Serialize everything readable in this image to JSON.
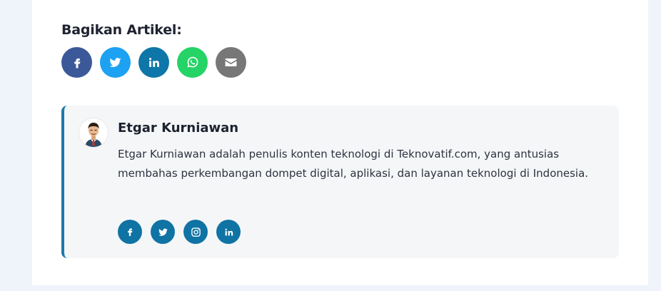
{
  "share": {
    "title": "Bagikan Artikel:",
    "buttons": [
      {
        "icon": "facebook-icon",
        "color": "#3b5998"
      },
      {
        "icon": "twitter-icon",
        "color": "#1da1f2"
      },
      {
        "icon": "linkedin-icon",
        "color": "#0e76a8"
      },
      {
        "icon": "whatsapp-icon",
        "color": "#25d366"
      },
      {
        "icon": "email-icon",
        "color": "#777777"
      }
    ]
  },
  "author": {
    "name": "Etgar Kurniawan",
    "bio": "Etgar Kurniawan adalah penulis konten teknologi di Teknovatif.com, yang antusias membahas perkembangan dompet digital, aplikasi, dan layanan teknologi di Indonesia.",
    "accent_color": "#1e79a8",
    "social": [
      {
        "icon": "facebook-icon"
      },
      {
        "icon": "twitter-icon"
      },
      {
        "icon": "instagram-icon"
      },
      {
        "icon": "linkedin-icon"
      }
    ],
    "social_color": "#0f73a4"
  }
}
